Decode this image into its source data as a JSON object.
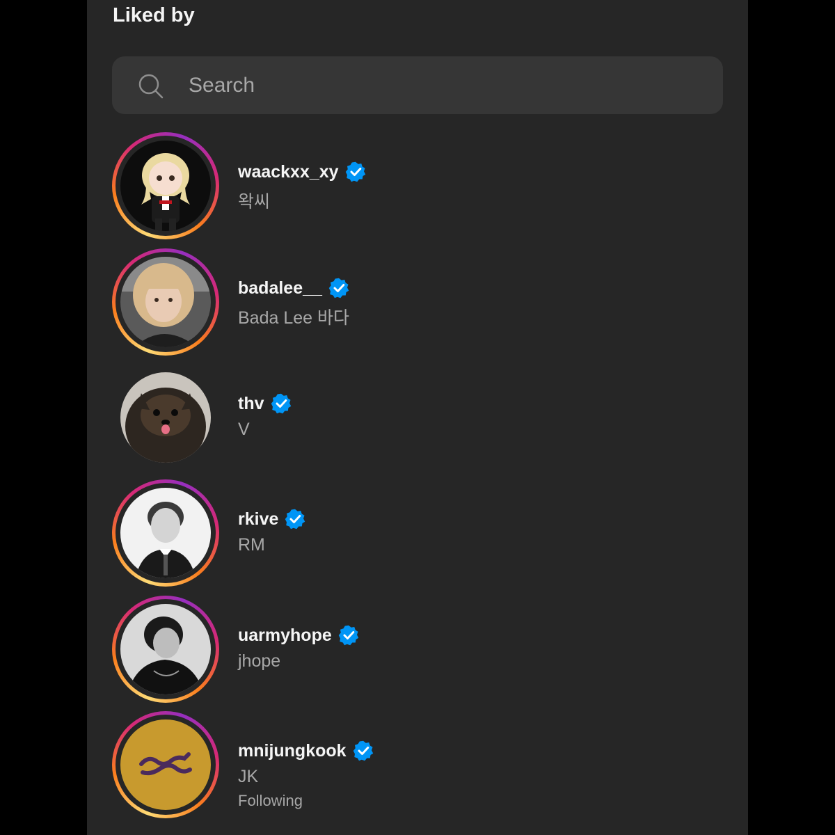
{
  "header": {
    "title": "Liked by"
  },
  "search": {
    "placeholder": "Search",
    "icon": "search-icon"
  },
  "colors": {
    "background": "#262626",
    "search_bg": "#363636",
    "verified": "#0095f6",
    "story_ring": [
      "#feda75",
      "#fa7e1e",
      "#d62976",
      "#962fbf"
    ]
  },
  "users": [
    {
      "username": "waackxx_xy",
      "full_name": "왁씨",
      "verified": true,
      "story_ring": true,
      "avatar": "cartoon-avatar"
    },
    {
      "username": "badalee__",
      "full_name": "Bada Lee 바다",
      "verified": true,
      "story_ring": true,
      "avatar": "photo-avatar"
    },
    {
      "username": "thv",
      "full_name": "V",
      "verified": true,
      "story_ring": false,
      "avatar": "dog-avatar"
    },
    {
      "username": "rkive",
      "full_name": "RM",
      "verified": true,
      "story_ring": true,
      "avatar": "photo-avatar"
    },
    {
      "username": "uarmyhope",
      "full_name": "jhope",
      "verified": true,
      "story_ring": true,
      "avatar": "photo-avatar"
    },
    {
      "username": "mnijungkook",
      "full_name": "JK",
      "subtitle": "Following",
      "verified": true,
      "story_ring": true,
      "avatar": "logo-avatar"
    }
  ]
}
